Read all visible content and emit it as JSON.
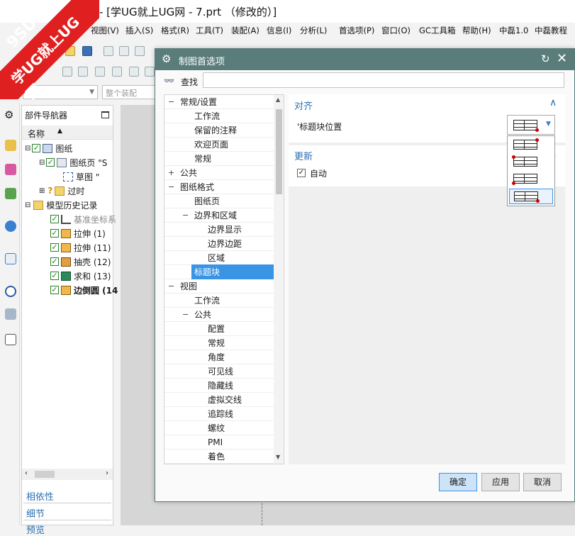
{
  "app": {
    "title": "- [学UG就上UG网 - 7.prt （修改的）]"
  },
  "watermark": {
    "top": "9SUG",
    "bottom": "学UG就上UG网"
  },
  "menubar": [
    {
      "key": "view",
      "label": "视图(V)"
    },
    {
      "key": "insert",
      "label": "插入(S)"
    },
    {
      "key": "format",
      "label": "格式(R)"
    },
    {
      "key": "tools",
      "label": "工具(T)"
    },
    {
      "key": "assembly",
      "label": "装配(A)"
    },
    {
      "key": "info",
      "label": "信息(I)"
    },
    {
      "key": "analysis",
      "label": "分析(L)"
    },
    {
      "key": "prefs",
      "label": "首选项(P)"
    },
    {
      "key": "window",
      "label": "窗口(O)"
    },
    {
      "key": "gc",
      "label": "GC工具箱"
    },
    {
      "key": "help",
      "label": "帮助(H)"
    },
    {
      "key": "zm",
      "label": "中磊1.0"
    },
    {
      "key": "zmtut",
      "label": "中磊教程"
    }
  ],
  "filterbar": {
    "assembly_scope": "整个装配"
  },
  "navigator": {
    "title": "部件导航器",
    "col_name": "名称",
    "rows": [
      {
        "label": "图纸",
        "state": "ok"
      },
      {
        "label": "图纸页 \"S"
      },
      {
        "label": "草图 \""
      },
      {
        "label": "过时",
        "state": "question"
      },
      {
        "label": "模型历史记录"
      },
      {
        "label": "基准坐标系"
      },
      {
        "label": "拉伸 (1)"
      },
      {
        "label": "拉伸 (11)"
      },
      {
        "label": "抽壳 (12)"
      },
      {
        "label": "求和 (13)"
      },
      {
        "label": "边倒圆 (14"
      }
    ],
    "sections": [
      "相依性",
      "细节",
      "预览"
    ]
  },
  "dialog": {
    "title": "制图首选项",
    "find_label": "查找",
    "find_value": "",
    "tree": [
      {
        "label": "常规/设置",
        "toggle": "−"
      },
      {
        "label": "工作流"
      },
      {
        "label": "保留的注释"
      },
      {
        "label": "欢迎页面"
      },
      {
        "label": "常规"
      },
      {
        "label": "公共",
        "toggle": "+"
      },
      {
        "label": "图纸格式",
        "toggle": "−"
      },
      {
        "label": "图纸页"
      },
      {
        "label": "边界和区域",
        "toggle": "−"
      },
      {
        "label": "边界显示"
      },
      {
        "label": "边界边距"
      },
      {
        "label": "区域"
      },
      {
        "label": "标题块",
        "selected": true
      },
      {
        "label": "视图",
        "toggle": "−"
      },
      {
        "label": "工作流"
      },
      {
        "label": "公共",
        "toggle": "−"
      },
      {
        "label": "配置"
      },
      {
        "label": "常规"
      },
      {
        "label": "角度"
      },
      {
        "label": "可见线"
      },
      {
        "label": "隐藏线"
      },
      {
        "label": "虚拟交线"
      },
      {
        "label": "追踪线"
      },
      {
        "label": "螺纹"
      },
      {
        "label": "PMI"
      },
      {
        "label": "着色"
      }
    ],
    "align_section": {
      "title": "对齐",
      "label": "'标题块位置"
    },
    "update_section": {
      "title": "更新",
      "auto_label": "自动",
      "auto_checked": true
    },
    "buttons": {
      "ok": "确定",
      "apply": "应用",
      "cancel": "取消"
    }
  }
}
